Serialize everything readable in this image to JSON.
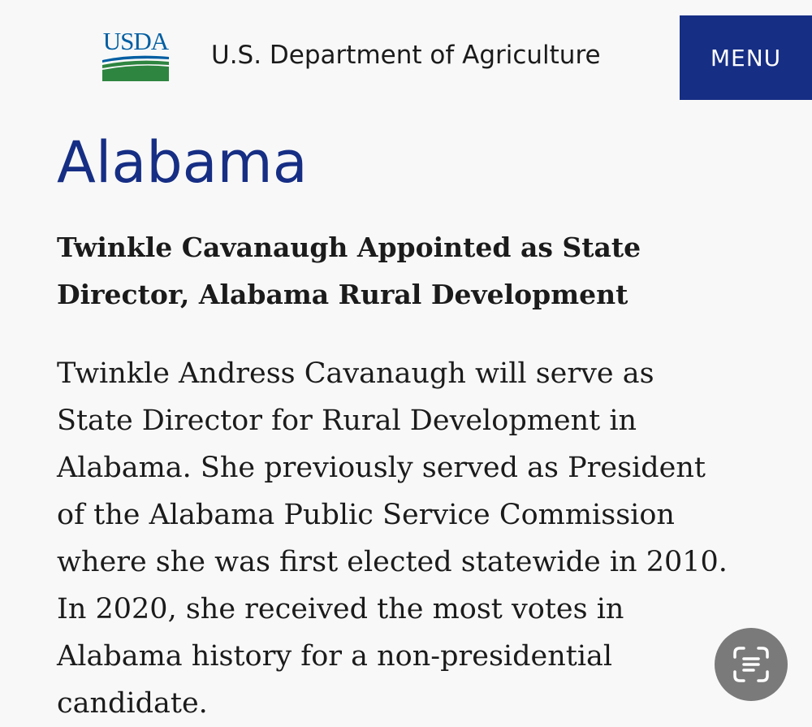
{
  "header": {
    "logo_text": "USDA",
    "agency_name": "U.S. Department of Agriculture",
    "menu_label": "MENU"
  },
  "page": {
    "title": "Alabama"
  },
  "article": {
    "headline": "Twinkle Cavanaugh Appointed as State Director, Alabama Rural Development",
    "body": "Twinkle Andress Cavanaugh will serve as State Director for Rural Development in Alabama. She previously served as President of the Alabama Public Service Commission where she was first elected statewide in 2010. In 2020, she received the most votes in Alabama history for a non-presidential candidate."
  },
  "floating_action": {
    "icon": "text-scan-icon"
  },
  "colors": {
    "brand_blue": "#162e84",
    "logo_blue": "#005ea2",
    "logo_green": "#2e8540",
    "fab_gray": "#7a7a7a",
    "background": "#f8f8f8"
  }
}
